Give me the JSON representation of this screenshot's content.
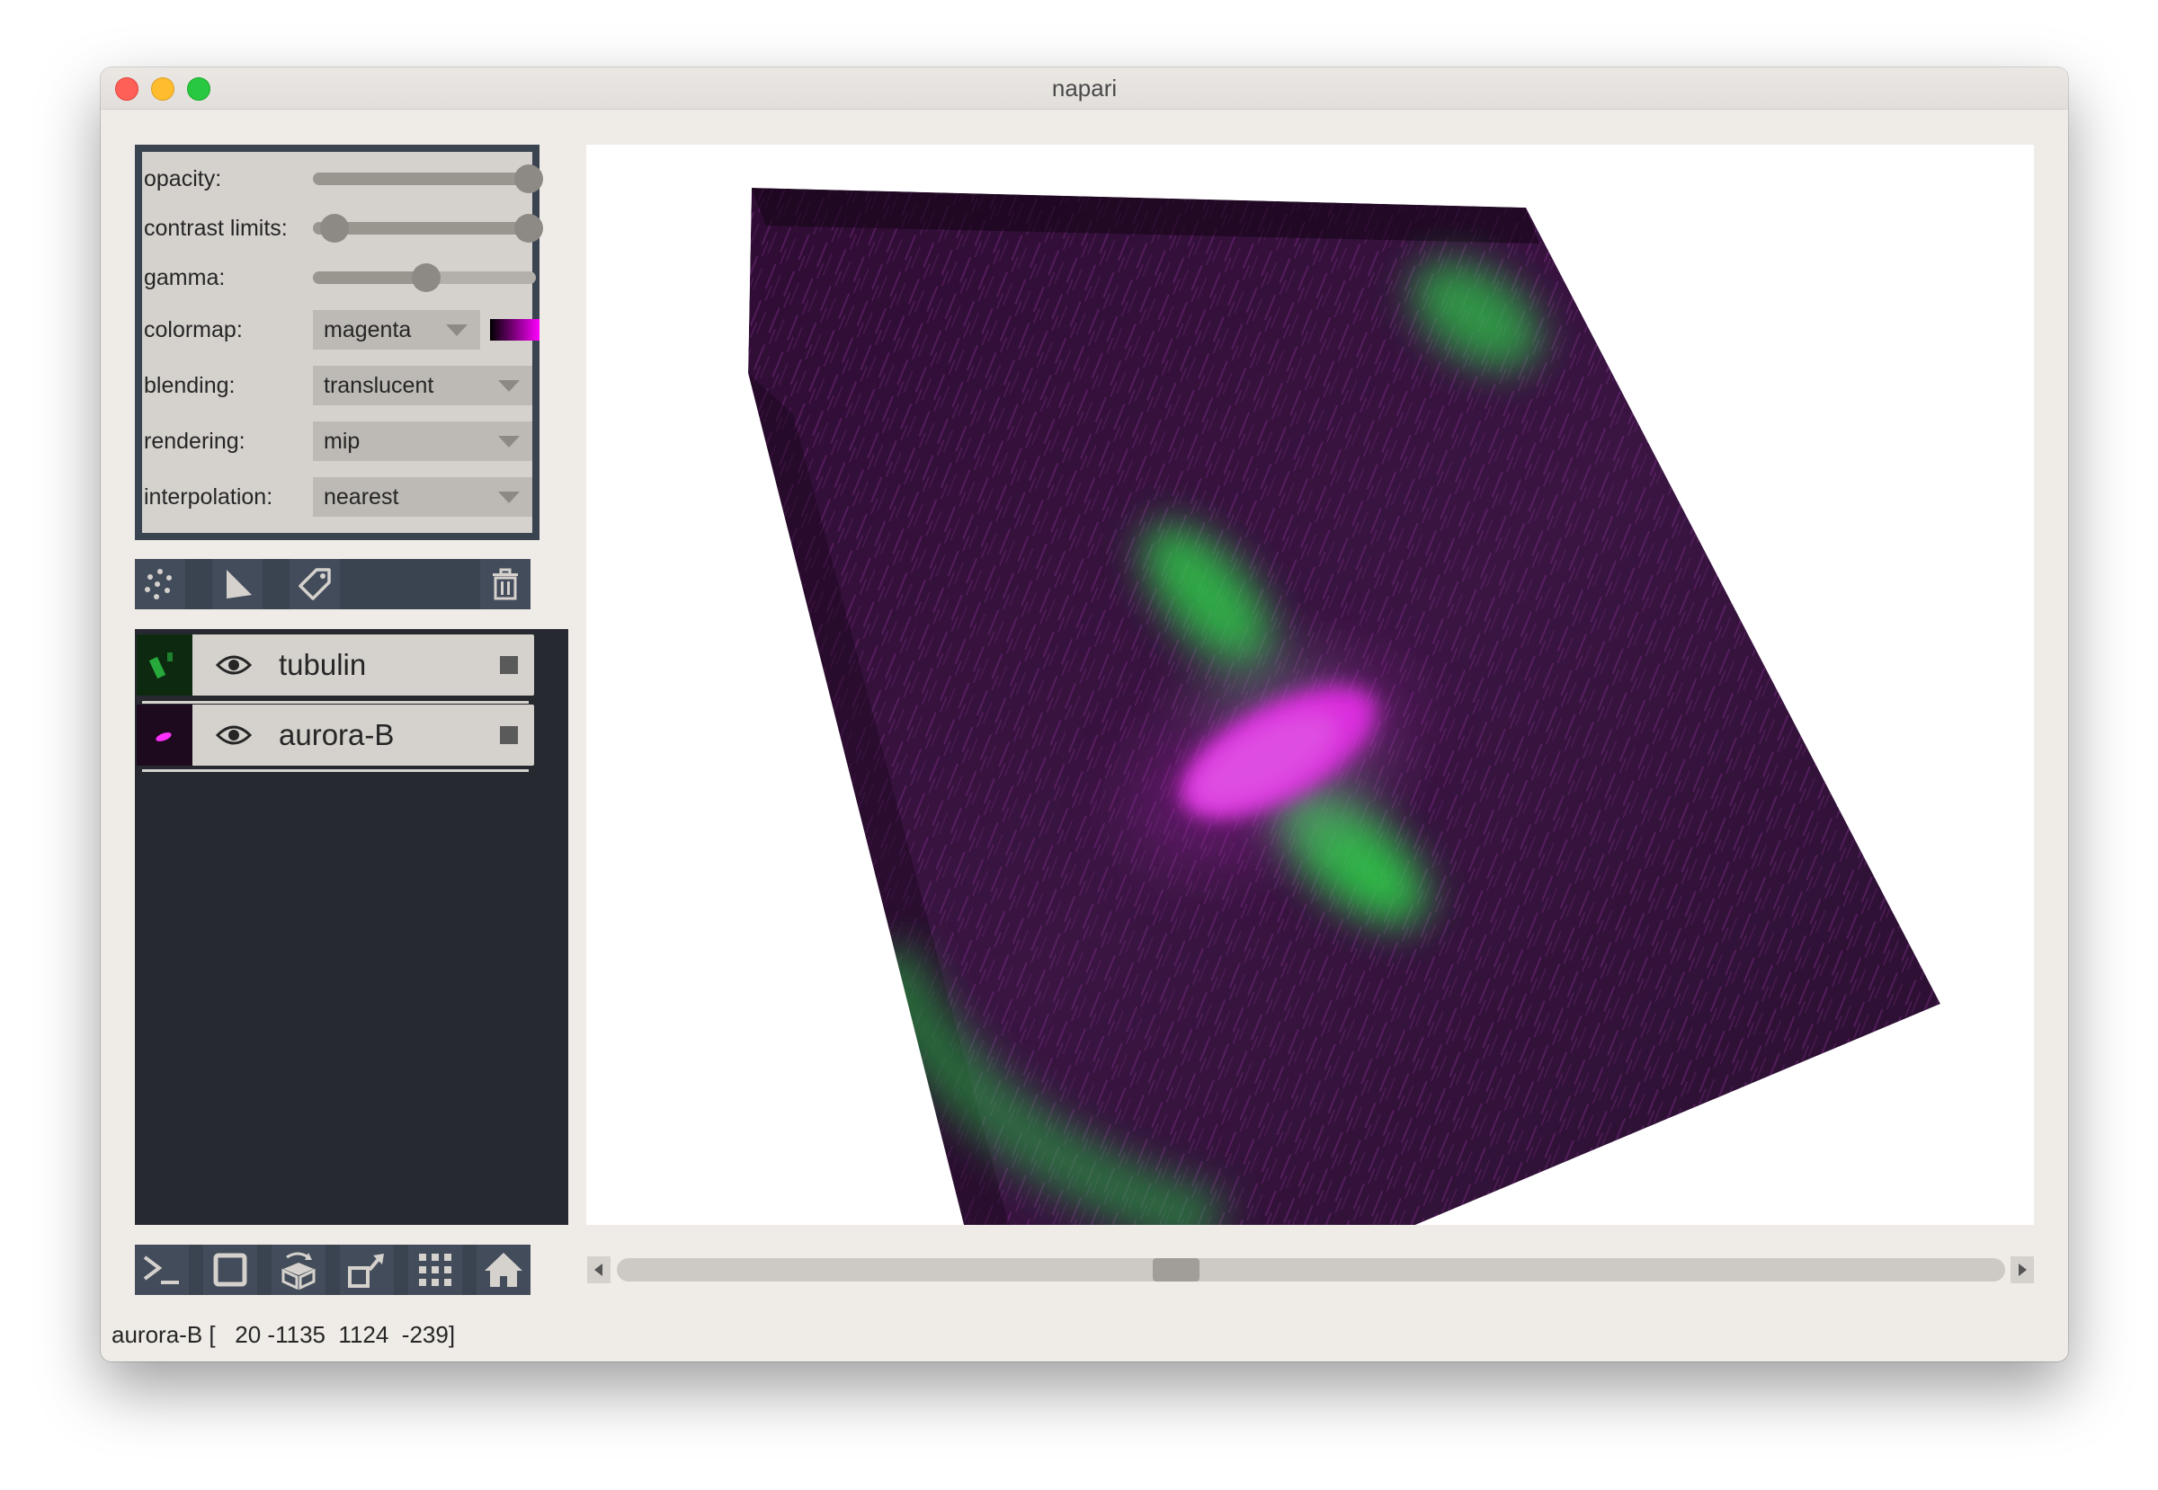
{
  "window": {
    "title": "napari"
  },
  "controls": {
    "opacity_label": "opacity:",
    "contrast_label": "contrast limits:",
    "gamma_label": "gamma:",
    "colormap_label": "colormap:",
    "colormap_value": "magenta",
    "blending_label": "blending:",
    "blending_value": "translucent",
    "rendering_label": "rendering:",
    "rendering_value": "mip",
    "interpolation_label": "interpolation:",
    "interpolation_value": "nearest",
    "opacity_level": 1.0,
    "contrast_limits_range": [
      0.0,
      1.0
    ],
    "gamma_level": 0.5
  },
  "layer_buttons": [
    "new-points-icon",
    "new-shapes-icon",
    "new-labels-icon",
    "delete-layer-icon"
  ],
  "layers": [
    {
      "name": "tubulin",
      "thumb_color": "#2fd34a"
    },
    {
      "name": "aurora-B",
      "thumb_color": "#ff30ff"
    }
  ],
  "viewer_buttons": [
    "console-icon",
    "ndisplay-square-icon",
    "roll-dims-icon",
    "transpose-icon",
    "grid-icon",
    "home-icon"
  ],
  "scrollbar": {
    "position": 0.59
  },
  "status": {
    "text": "aurora-B [   20 -1135  1124  -239]"
  },
  "colors": {
    "panel_dark": "#262930",
    "panel_mid": "#3a4350",
    "foreground": "#d5d1cd",
    "tubulin": "#2fd34a",
    "aurora": "#ff30ff"
  }
}
